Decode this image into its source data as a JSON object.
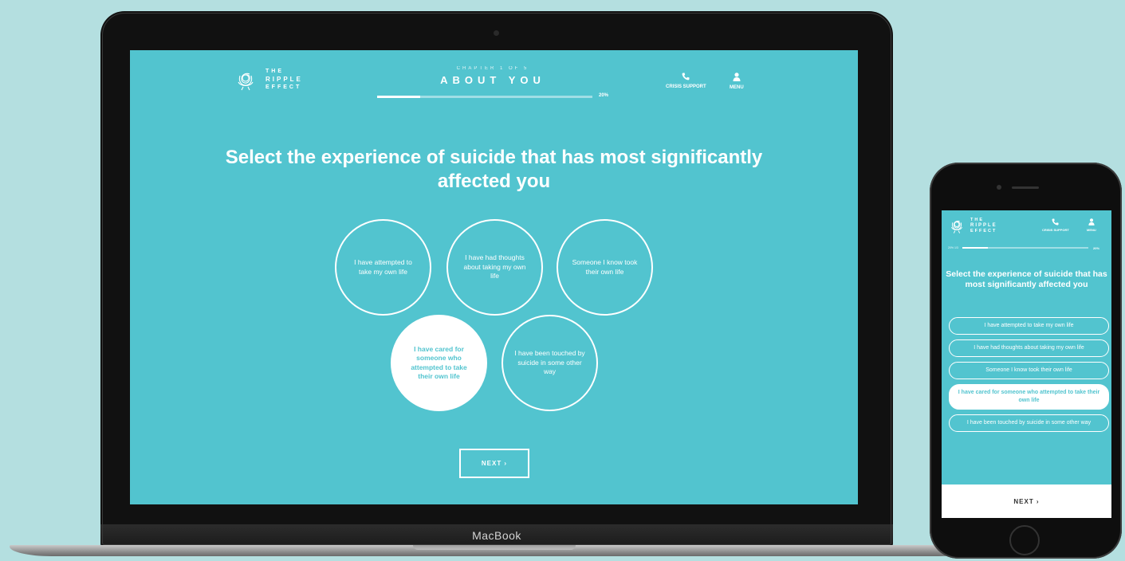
{
  "brand": {
    "logo_lines": [
      "THE",
      "RIPPLE",
      "EFFECT"
    ],
    "device_label": "MacBook"
  },
  "header": {
    "chapter_label": "CHAPTER 1 OF 5",
    "chapter_title": "ABOUT YOU",
    "progress_percent": 20,
    "progress_text": "20%",
    "crisis_support_label": "CRISIS SUPPORT",
    "menu_label": "MENU",
    "mobile_progress_label": "20% 1/3"
  },
  "question": "Select the experience of suicide that has most significantly affected you",
  "options": [
    {
      "label": "I have attempted to take my own life",
      "selected": false
    },
    {
      "label": "I have had thoughts about taking my own life",
      "selected": false
    },
    {
      "label": "Someone I know took their own life",
      "selected": false
    },
    {
      "label": "I have cared for someone who attempted to take their own life",
      "selected": true
    },
    {
      "label": "I have been touched by suicide in some other way",
      "selected": false
    }
  ],
  "next_label": "NEXT ›",
  "icons": {
    "logo": "ripple-rose-icon",
    "crisis": "phone-icon",
    "menu": "person-icon"
  },
  "colors": {
    "background": "#b4dfe0",
    "screen": "#52c4cf",
    "foreground": "#ffffff"
  }
}
